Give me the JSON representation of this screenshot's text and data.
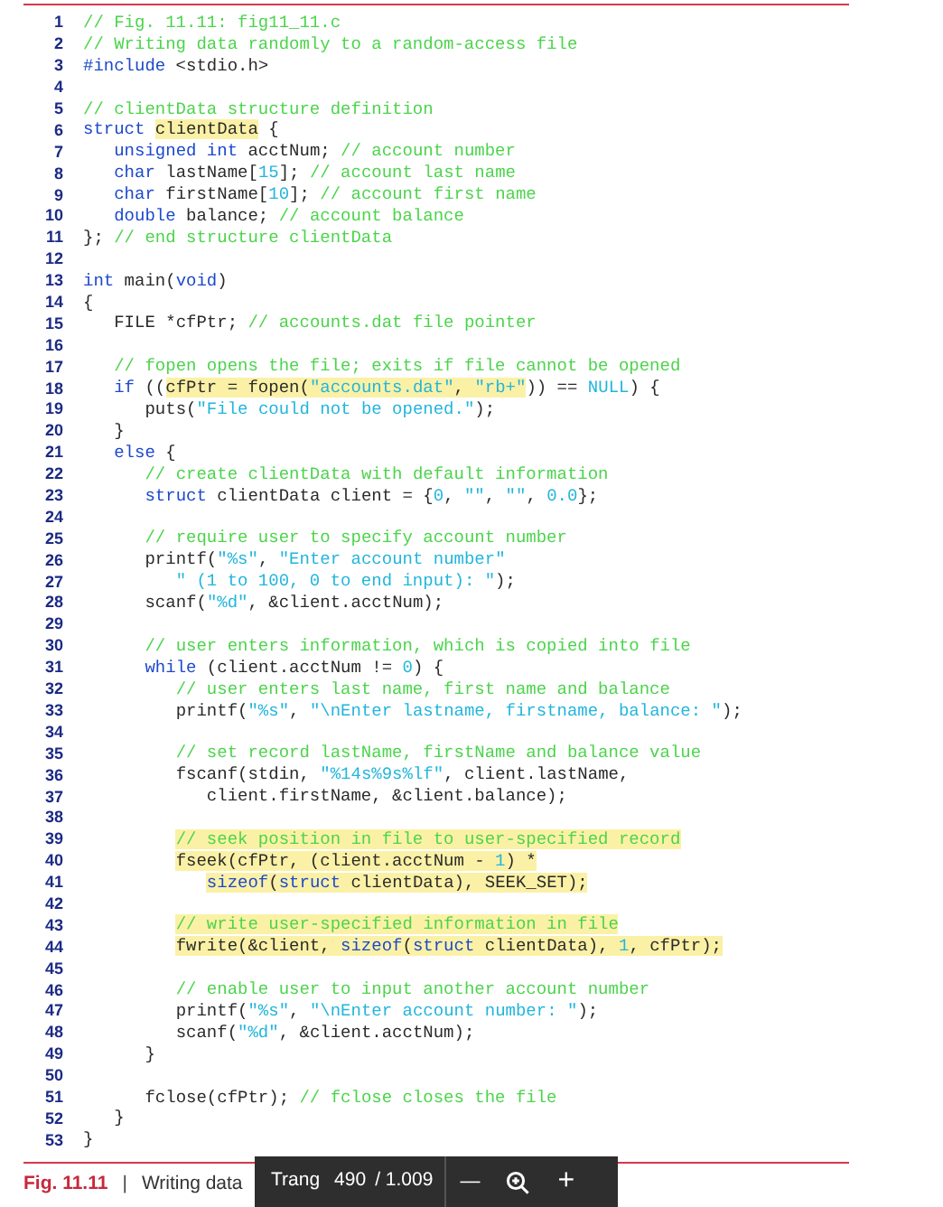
{
  "code_lines": [
    {
      "n": "1",
      "code": [
        {
          "text": "// Fig. 11.11: fig11_11.c",
          "kind": "comment",
          "highlighted": false
        }
      ]
    },
    {
      "n": "2",
      "code": [
        {
          "text": "// Writing data randomly to a random-access file",
          "kind": "comment",
          "highlighted": false
        }
      ]
    },
    {
      "n": "3",
      "code": [
        {
          "text": "#include",
          "kind": "keyword",
          "highlighted": false
        },
        {
          "text": " <stdio.h>",
          "kind": "plain",
          "highlighted": false
        }
      ]
    },
    {
      "n": "4"
    },
    {
      "n": "5",
      "code": [
        {
          "text": "// clientData structure definition",
          "kind": "comment",
          "highlighted": false
        }
      ]
    },
    {
      "n": "6",
      "code": [
        {
          "text": "struct ",
          "kind": "keyword",
          "highlighted": false
        },
        {
          "text": "clientData",
          "kind": "plain",
          "highlighted": true
        },
        {
          "text": " {",
          "kind": "plain",
          "highlighted": false
        }
      ]
    },
    {
      "n": "7",
      "code": [
        {
          "text": "   unsigned int",
          "kind": "keyword",
          "highlighted": false
        },
        {
          "text": " acctNum; ",
          "kind": "plain",
          "highlighted": false
        },
        {
          "text": "// account number",
          "kind": "comment",
          "highlighted": false
        }
      ]
    },
    {
      "n": "8",
      "code": [
        {
          "text": "   char",
          "kind": "keyword",
          "highlighted": false
        },
        {
          "text": " lastName[",
          "kind": "plain",
          "highlighted": false
        },
        {
          "text": "15",
          "kind": "literal",
          "highlighted": false
        },
        {
          "text": "]; ",
          "kind": "plain",
          "highlighted": false
        },
        {
          "text": "// account last name",
          "kind": "comment",
          "highlighted": false
        }
      ]
    },
    {
      "n": "9",
      "code": [
        {
          "text": "   char",
          "kind": "keyword",
          "highlighted": false
        },
        {
          "text": " firstName[",
          "kind": "plain",
          "highlighted": false
        },
        {
          "text": "10",
          "kind": "literal",
          "highlighted": false
        },
        {
          "text": "]; ",
          "kind": "plain",
          "highlighted": false
        },
        {
          "text": "// account first name",
          "kind": "comment",
          "highlighted": false
        }
      ]
    },
    {
      "n": "10",
      "code": [
        {
          "text": "   double",
          "kind": "keyword",
          "highlighted": false
        },
        {
          "text": " balance; ",
          "kind": "plain",
          "highlighted": false
        },
        {
          "text": "// account balance",
          "kind": "comment",
          "highlighted": false
        }
      ]
    },
    {
      "n": "11",
      "code": [
        {
          "text": "}; ",
          "kind": "plain",
          "highlighted": false
        },
        {
          "text": "// end structure clientData",
          "kind": "comment",
          "highlighted": false
        }
      ]
    },
    {
      "n": "12"
    },
    {
      "n": "13",
      "code": [
        {
          "text": "int",
          "kind": "keyword",
          "highlighted": false
        },
        {
          "text": " main(",
          "kind": "plain",
          "highlighted": false
        },
        {
          "text": "void",
          "kind": "keyword",
          "highlighted": false
        },
        {
          "text": ")",
          "kind": "plain",
          "highlighted": false
        }
      ]
    },
    {
      "n": "14",
      "code": [
        {
          "text": "{",
          "kind": "plain",
          "highlighted": false
        }
      ]
    },
    {
      "n": "15",
      "code": [
        {
          "text": "   FILE *cfPtr; ",
          "kind": "plain",
          "highlighted": false
        },
        {
          "text": "// accounts.dat file pointer",
          "kind": "comment",
          "highlighted": false
        }
      ]
    },
    {
      "n": "16"
    },
    {
      "n": "17",
      "code": [
        {
          "text": "   // fopen opens the file; exits if file cannot be opened",
          "kind": "comment",
          "highlighted": false
        }
      ]
    },
    {
      "n": "18",
      "code": [
        {
          "text": "   if",
          "kind": "keyword",
          "highlighted": false
        },
        {
          "text": " ((",
          "kind": "plain",
          "highlighted": false
        },
        {
          "text": "cfPtr = fopen(",
          "kind": "plain",
          "highlighted": true
        },
        {
          "text": "\"accounts.dat\"",
          "kind": "literal",
          "highlighted": true
        },
        {
          "text": ", ",
          "kind": "plain",
          "highlighted": true
        },
        {
          "text": "\"rb+\"",
          "kind": "literal",
          "highlighted": true
        },
        {
          "text": ")) == ",
          "kind": "plain",
          "highlighted": false
        },
        {
          "text": "NULL",
          "kind": "literal",
          "highlighted": false
        },
        {
          "text": ") {",
          "kind": "plain",
          "highlighted": false
        }
      ]
    },
    {
      "n": "19",
      "code": [
        {
          "text": "      puts(",
          "kind": "plain",
          "highlighted": false
        },
        {
          "text": "\"File could not be opened.\"",
          "kind": "literal",
          "highlighted": false
        },
        {
          "text": ");",
          "kind": "plain",
          "highlighted": false
        }
      ]
    },
    {
      "n": "20",
      "code": [
        {
          "text": "   }",
          "kind": "plain",
          "highlighted": false
        }
      ]
    },
    {
      "n": "21",
      "code": [
        {
          "text": "   else",
          "kind": "keyword",
          "highlighted": false
        },
        {
          "text": " {",
          "kind": "plain",
          "highlighted": false
        }
      ]
    },
    {
      "n": "22",
      "code": [
        {
          "text": "      // create clientData with default information",
          "kind": "comment",
          "highlighted": false
        }
      ]
    },
    {
      "n": "23",
      "code": [
        {
          "text": "      struct",
          "kind": "keyword",
          "highlighted": false
        },
        {
          "text": " clientData client = {",
          "kind": "plain",
          "highlighted": false
        },
        {
          "text": "0",
          "kind": "literal",
          "highlighted": false
        },
        {
          "text": ", ",
          "kind": "plain",
          "highlighted": false
        },
        {
          "text": "\"\"",
          "kind": "literal",
          "highlighted": false
        },
        {
          "text": ", ",
          "kind": "plain",
          "highlighted": false
        },
        {
          "text": "\"\"",
          "kind": "literal",
          "highlighted": false
        },
        {
          "text": ", ",
          "kind": "plain",
          "highlighted": false
        },
        {
          "text": "0.0",
          "kind": "literal",
          "highlighted": false
        },
        {
          "text": "};",
          "kind": "plain",
          "highlighted": false
        }
      ]
    },
    {
      "n": "24"
    },
    {
      "n": "25",
      "code": [
        {
          "text": "      // require user to specify account number",
          "kind": "comment",
          "highlighted": false
        }
      ]
    },
    {
      "n": "26",
      "code": [
        {
          "text": "      printf(",
          "kind": "plain",
          "highlighted": false
        },
        {
          "text": "\"%s\"",
          "kind": "literal",
          "highlighted": false
        },
        {
          "text": ", ",
          "kind": "plain",
          "highlighted": false
        },
        {
          "text": "\"Enter account number\"",
          "kind": "literal",
          "highlighted": false
        }
      ]
    },
    {
      "n": "27",
      "code": [
        {
          "text": "         \" (1 to 100, 0 to end input): \"",
          "kind": "literal",
          "highlighted": false
        },
        {
          "text": ");",
          "kind": "plain",
          "highlighted": false
        }
      ]
    },
    {
      "n": "28",
      "code": [
        {
          "text": "      scanf(",
          "kind": "plain",
          "highlighted": false
        },
        {
          "text": "\"%d\"",
          "kind": "literal",
          "highlighted": false
        },
        {
          "text": ", &client.acctNum);",
          "kind": "plain",
          "highlighted": false
        }
      ]
    },
    {
      "n": "29"
    },
    {
      "n": "30",
      "code": [
        {
          "text": "      // user enters information, which is copied into file",
          "kind": "comment",
          "highlighted": false
        }
      ]
    },
    {
      "n": "31",
      "code": [
        {
          "text": "      while",
          "kind": "keyword",
          "highlighted": false
        },
        {
          "text": " (client.acctNum != ",
          "kind": "plain",
          "highlighted": false
        },
        {
          "text": "0",
          "kind": "literal",
          "highlighted": false
        },
        {
          "text": ") {",
          "kind": "plain",
          "highlighted": false
        }
      ]
    },
    {
      "n": "32",
      "code": [
        {
          "text": "         // user enters last name, first name and balance",
          "kind": "comment",
          "highlighted": false
        }
      ]
    },
    {
      "n": "33",
      "code": [
        {
          "text": "         printf(",
          "kind": "plain",
          "highlighted": false
        },
        {
          "text": "\"%s\"",
          "kind": "literal",
          "highlighted": false
        },
        {
          "text": ", ",
          "kind": "plain",
          "highlighted": false
        },
        {
          "text": "\"\\nEnter lastname, firstname, balance: \"",
          "kind": "literal",
          "highlighted": false
        },
        {
          "text": ");",
          "kind": "plain",
          "highlighted": false
        }
      ]
    },
    {
      "n": "34"
    },
    {
      "n": "35",
      "code": [
        {
          "text": "         // set record lastName, firstName and balance value",
          "kind": "comment",
          "highlighted": false
        }
      ]
    },
    {
      "n": "36",
      "code": [
        {
          "text": "         fscanf(stdin, ",
          "kind": "plain",
          "highlighted": false
        },
        {
          "text": "\"%14s%9s%lf\"",
          "kind": "literal",
          "highlighted": false
        },
        {
          "text": ", client.lastName,",
          "kind": "plain",
          "highlighted": false
        }
      ]
    },
    {
      "n": "37",
      "code": [
        {
          "text": "            client.firstName, &client.balance);",
          "kind": "plain",
          "highlighted": false
        }
      ]
    },
    {
      "n": "38"
    },
    {
      "n": "39",
      "code": [
        {
          "text": "         // seek position in file to user-specified record",
          "kind": "comment",
          "highlighted": true
        }
      ]
    },
    {
      "n": "40",
      "code": [
        {
          "text": "         fseek(cfPtr, (client.acctNum - ",
          "kind": "plain",
          "highlighted": true
        },
        {
          "text": "1",
          "kind": "literal",
          "highlighted": true
        },
        {
          "text": ") *",
          "kind": "plain",
          "highlighted": true
        }
      ]
    },
    {
      "n": "41",
      "code": [
        {
          "text": "            sizeof",
          "kind": "keyword",
          "highlighted": true
        },
        {
          "text": "(",
          "kind": "plain",
          "highlighted": true
        },
        {
          "text": "struct",
          "kind": "keyword",
          "highlighted": true
        },
        {
          "text": " clientData), SEEK_SET);",
          "kind": "plain",
          "highlighted": true
        }
      ]
    },
    {
      "n": "42"
    },
    {
      "n": "43",
      "code": [
        {
          "text": "         // write user-specified information in file",
          "kind": "comment",
          "highlighted": true
        }
      ]
    },
    {
      "n": "44",
      "code": [
        {
          "text": "         fwrite(&client, ",
          "kind": "plain",
          "highlighted": true
        },
        {
          "text": "sizeof",
          "kind": "keyword",
          "highlighted": true
        },
        {
          "text": "(",
          "kind": "plain",
          "highlighted": true
        },
        {
          "text": "struct",
          "kind": "keyword",
          "highlighted": true
        },
        {
          "text": " clientData), ",
          "kind": "plain",
          "highlighted": true
        },
        {
          "text": "1",
          "kind": "literal",
          "highlighted": true
        },
        {
          "text": ", cfPtr);",
          "kind": "plain",
          "highlighted": true
        }
      ]
    },
    {
      "n": "45"
    },
    {
      "n": "46",
      "code": [
        {
          "text": "         // enable user to input another account number",
          "kind": "comment",
          "highlighted": false
        }
      ]
    },
    {
      "n": "47",
      "code": [
        {
          "text": "         printf(",
          "kind": "plain",
          "highlighted": false
        },
        {
          "text": "\"%s\"",
          "kind": "literal",
          "highlighted": false
        },
        {
          "text": ", ",
          "kind": "plain",
          "highlighted": false
        },
        {
          "text": "\"\\nEnter account number: \"",
          "kind": "literal",
          "highlighted": false
        },
        {
          "text": ");",
          "kind": "plain",
          "highlighted": false
        }
      ]
    },
    {
      "n": "48",
      "code": [
        {
          "text": "         scanf(",
          "kind": "plain",
          "highlighted": false
        },
        {
          "text": "\"%d\"",
          "kind": "literal",
          "highlighted": false
        },
        {
          "text": ", &client.acctNum);",
          "kind": "plain",
          "highlighted": false
        }
      ]
    },
    {
      "n": "49",
      "code": [
        {
          "text": "      }",
          "kind": "plain",
          "highlighted": false
        }
      ]
    },
    {
      "n": "50"
    },
    {
      "n": "51",
      "code": [
        {
          "text": "      fclose(cfPtr); ",
          "kind": "plain",
          "highlighted": false
        },
        {
          "text": "// fclose closes the file",
          "kind": "comment",
          "highlighted": false
        }
      ]
    },
    {
      "n": "52",
      "code": [
        {
          "text": "   }",
          "kind": "plain",
          "highlighted": false
        }
      ]
    },
    {
      "n": "53",
      "code": [
        {
          "text": "}",
          "kind": "plain",
          "highlighted": false
        }
      ]
    }
  ],
  "caption": {
    "label": "Fig. 11.11",
    "separator": "|",
    "text": "Writing data"
  },
  "viewer_toolbar": {
    "page_label": "Trang",
    "page_number": "490",
    "page_total": "/ 1.009",
    "zoom_out": "—",
    "zoom_in": "+"
  }
}
